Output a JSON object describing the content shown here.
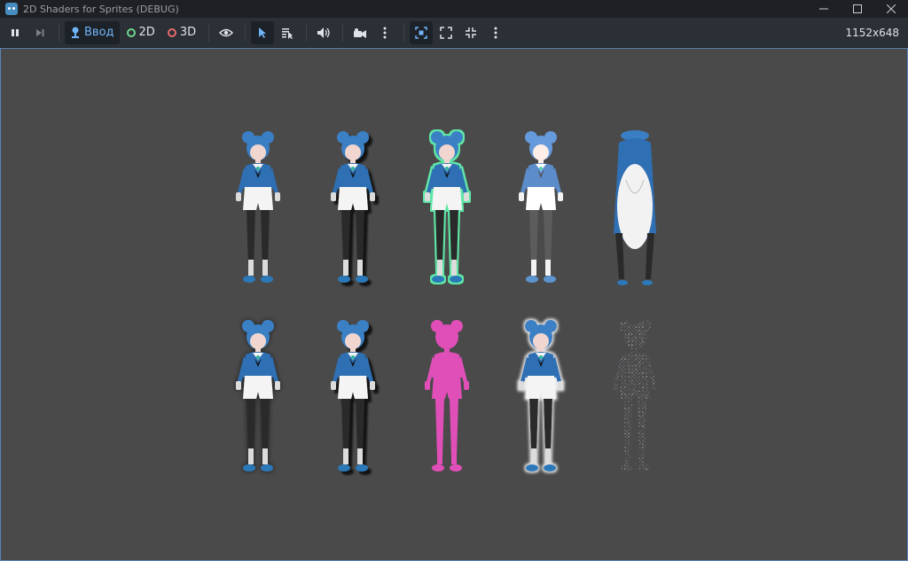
{
  "window": {
    "title": "2D Shaders for Sprites (DEBUG)",
    "controls": [
      "minimize",
      "maximize",
      "close"
    ]
  },
  "toolbar": {
    "pause_icon": "pause-icon",
    "step_icon": "step-frame-icon",
    "input_label": "Ввод",
    "mode_2d_label": "2D",
    "mode_3d_label": "3D",
    "mode_2d_color": "#6fd58a",
    "mode_3d_color": "#e56b6b",
    "resolution": "1152x648"
  },
  "viewport": {
    "background": "#4a4a4a",
    "sprites": [
      {
        "variant": "normal"
      },
      {
        "variant": "shadow"
      },
      {
        "variant": "outline",
        "outline_color": "#5ee6a6"
      },
      {
        "variant": "brightened"
      },
      {
        "variant": "distorted"
      },
      {
        "variant": "dark-blur"
      },
      {
        "variant": "drop-shadow"
      },
      {
        "variant": "silhouette",
        "fill_color": "#e04fb8"
      },
      {
        "variant": "glow"
      },
      {
        "variant": "dissolve"
      }
    ]
  }
}
